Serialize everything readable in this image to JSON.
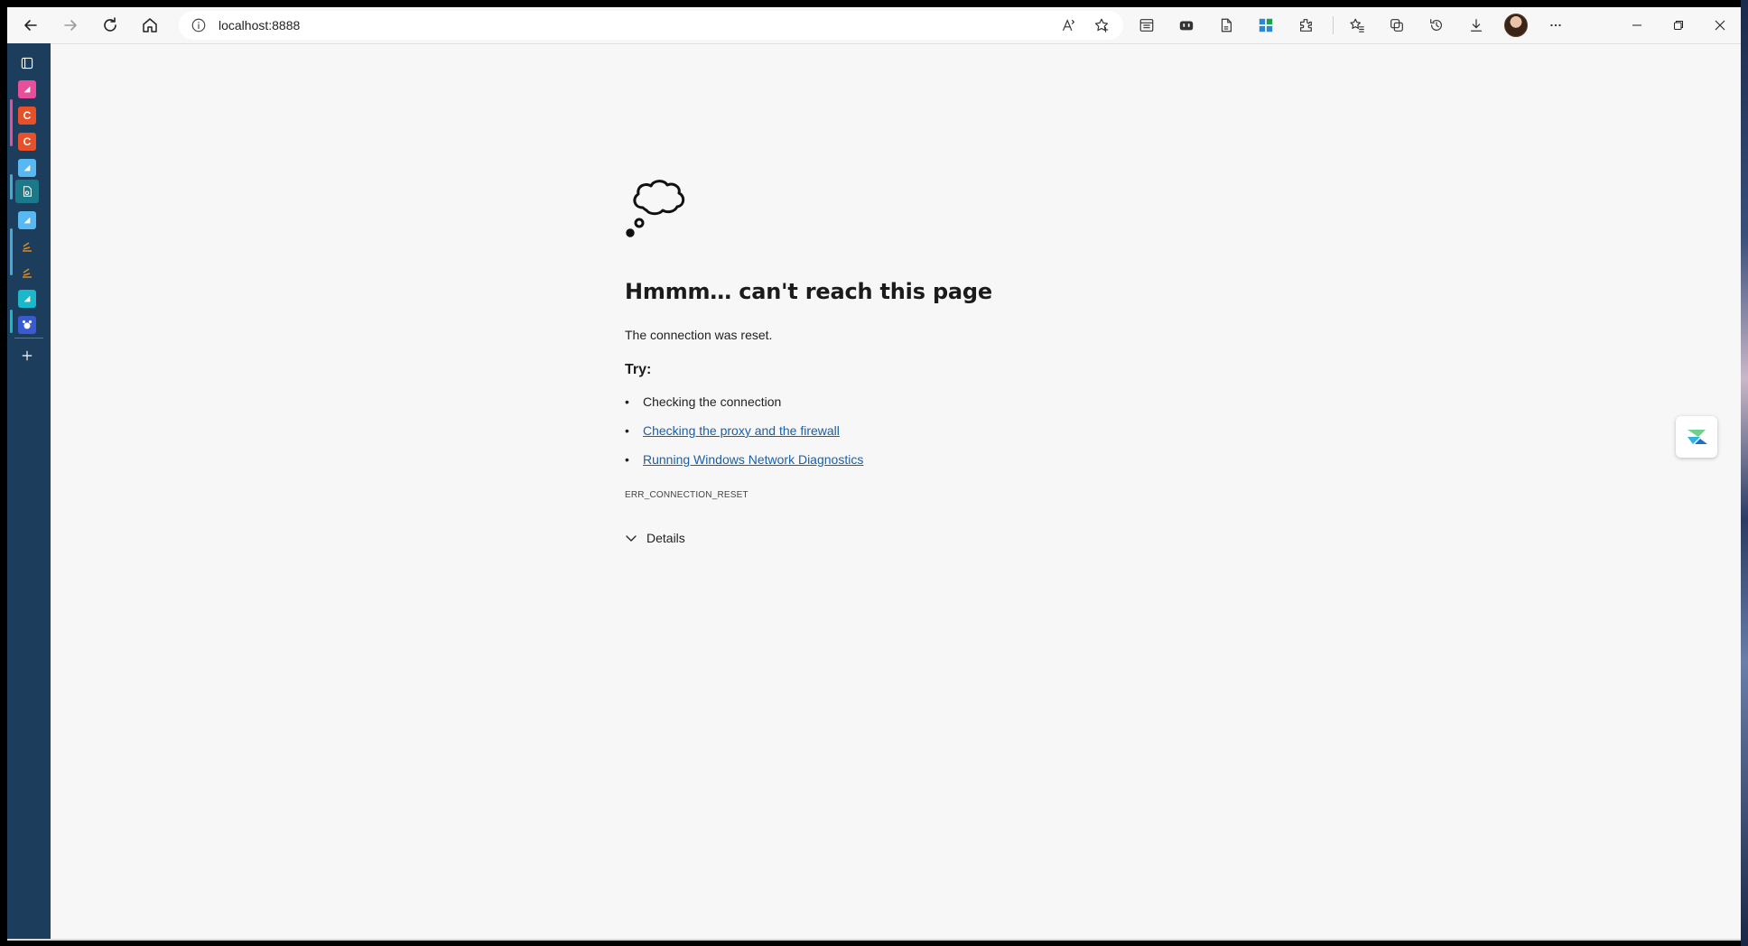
{
  "browser": {
    "url": "localhost:8888",
    "nav": {
      "back": "back-arrow-icon",
      "forward": "forward-arrow-icon",
      "refresh": "refresh-icon",
      "home": "home-icon"
    }
  },
  "sidebar": {
    "items": [
      {
        "name": "tabs-icon",
        "color": "#1d3d5c"
      },
      {
        "name": "app-pink",
        "color": "#e94e9a"
      },
      {
        "name": "app-c-orange-1",
        "color": "#e8502a",
        "label": "C"
      },
      {
        "name": "app-c-orange-2",
        "color": "#e8502a",
        "label": "C"
      },
      {
        "name": "app-lightblue-1",
        "color": "#57b8f2"
      },
      {
        "name": "app-doc-teal",
        "color": "#1a7a8c"
      },
      {
        "name": "app-lightblue-2",
        "color": "#57b8f2"
      },
      {
        "name": "app-stack-1",
        "color": "#d78a2a"
      },
      {
        "name": "app-stack-2",
        "color": "#d78a2a"
      },
      {
        "name": "app-teal",
        "color": "#1ab8c8"
      },
      {
        "name": "app-cat",
        "color": "#3a5ad0"
      }
    ],
    "add": "add-icon"
  },
  "error": {
    "title": "Hmmm… can't reach this page",
    "description": "The connection was reset.",
    "try_label": "Try:",
    "suggestions": [
      {
        "text": "Checking the connection",
        "link": false
      },
      {
        "text": "Checking the proxy and the firewall",
        "link": true
      },
      {
        "text": "Running Windows Network Diagnostics",
        "link": true
      }
    ],
    "code": "ERR_CONNECTION_RESET",
    "details_label": "Details"
  },
  "colors": {
    "sidebar": "#1d3d5c",
    "link": "#1a5fa8",
    "background": "#f7f7f7"
  }
}
